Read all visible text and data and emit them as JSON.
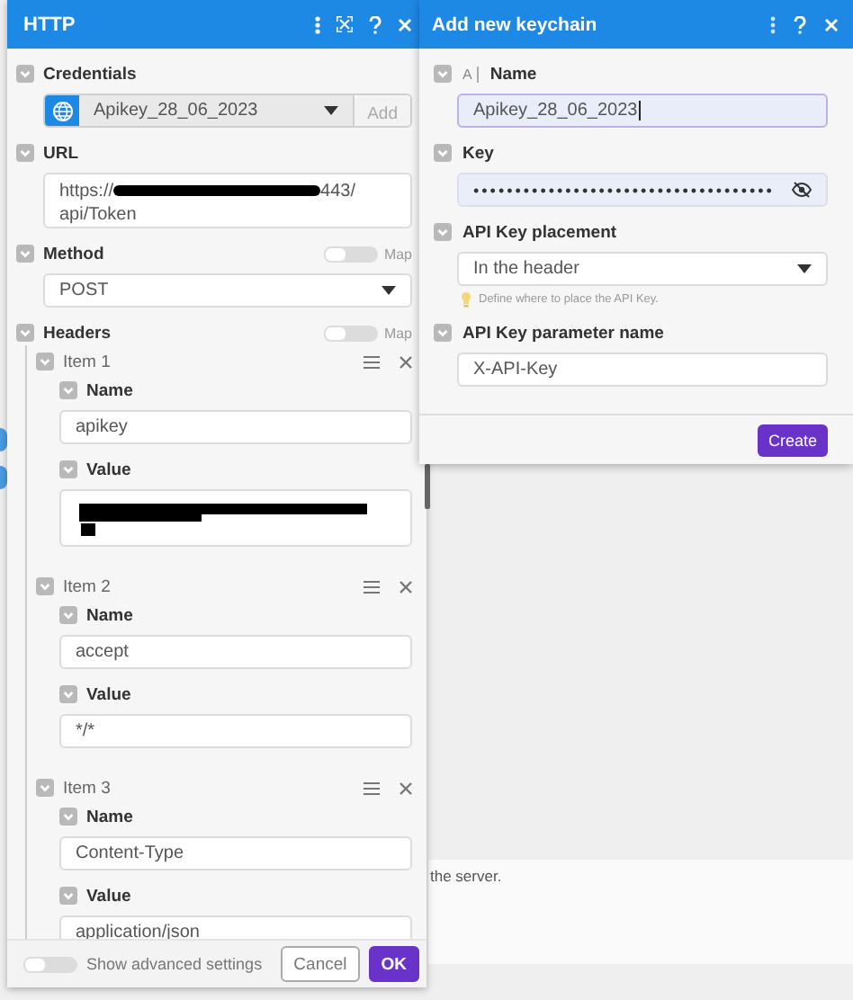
{
  "background": {
    "text": "the server."
  },
  "http": {
    "title": "HTTP",
    "credentials": {
      "label": "Credentials",
      "value": "Apikey_28_06_2023",
      "button": "Add"
    },
    "url": {
      "label": "URL",
      "before": "https://",
      "after": "443/",
      "line2": "api/Token",
      "redacted": true
    },
    "method": {
      "label": "Method",
      "value": "POST",
      "map": {
        "label": "Map",
        "on": false
      }
    },
    "headers": {
      "label": "Headers",
      "map": {
        "label": "Map",
        "on": false
      },
      "items": [
        {
          "title": "Item 1",
          "fields": [
            {
              "label": "Name",
              "value": "apikey",
              "kind": "text"
            },
            {
              "label": "Value",
              "kind": "redacted"
            }
          ]
        },
        {
          "title": "Item 2",
          "fields": [
            {
              "label": "Name",
              "value": "accept",
              "kind": "text"
            },
            {
              "label": "Value",
              "value": "*/*",
              "kind": "text"
            }
          ]
        },
        {
          "title": "Item 3",
          "fields": [
            {
              "label": "Name",
              "value": "Content-Type",
              "kind": "text"
            },
            {
              "label": "Value",
              "value": "application/json",
              "kind": "text"
            }
          ]
        }
      ]
    },
    "advanced": {
      "label": "Show advanced settings",
      "on": false
    },
    "buttons": [
      {
        "label": "Cancel",
        "kind": "secondary"
      },
      {
        "label": "OK",
        "kind": "primary"
      }
    ]
  },
  "keychain": {
    "title": "Add new keychain",
    "fields": [
      {
        "kind": "text",
        "type_mark": "A",
        "label": "Name",
        "value": "Apikey_28_06_2023",
        "focused": true
      },
      {
        "kind": "password",
        "label": "Key",
        "value": "••••••••••••••••••••••••••••••••••••"
      },
      {
        "kind": "select",
        "label": "API Key placement",
        "value": "In the header",
        "hint": "Define where to place the API Key."
      },
      {
        "kind": "text",
        "label": "API Key parameter name",
        "value": "X-API-Key",
        "focused": false
      }
    ],
    "button": "Create"
  }
}
